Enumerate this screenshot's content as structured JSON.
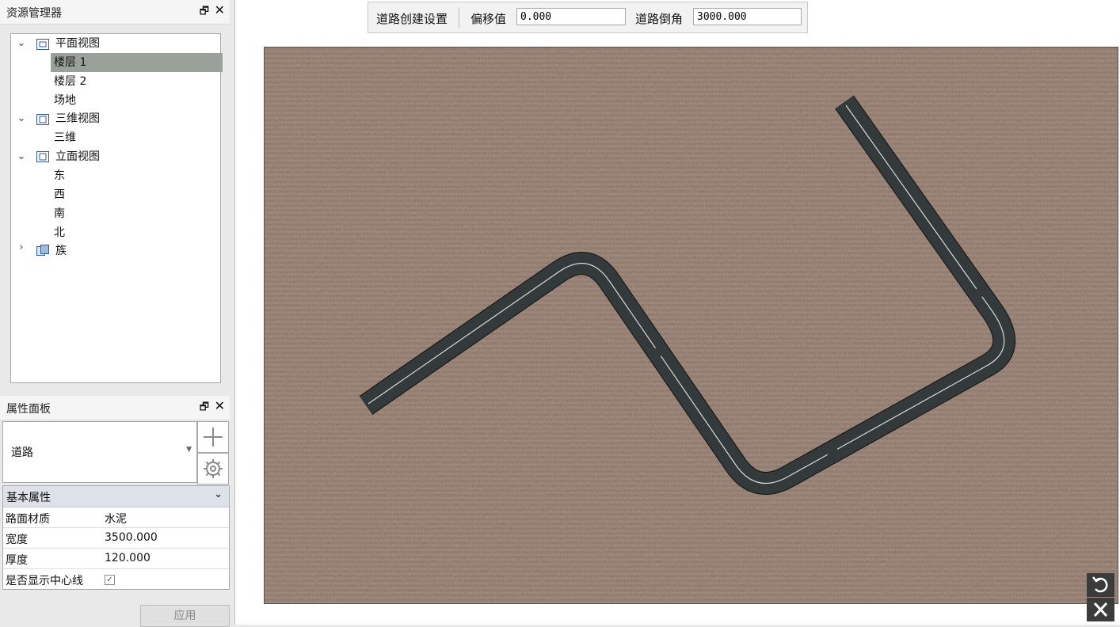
{
  "resource_panel": {
    "title": "资源管理器",
    "tree": [
      {
        "label": "平面视图",
        "icon": "plan-view-icon",
        "expanded": true
      },
      {
        "label": "楼层 1",
        "selected": true
      },
      {
        "label": "楼层 2"
      },
      {
        "label": "场地"
      },
      {
        "label": "三维视图",
        "icon": "3d-view-icon",
        "expanded": true
      },
      {
        "label": "三维"
      },
      {
        "label": "立面视图",
        "icon": "elevation-view-icon",
        "expanded": true
      },
      {
        "label": "东"
      },
      {
        "label": "西"
      },
      {
        "label": "南"
      },
      {
        "label": "北"
      },
      {
        "label": "族",
        "icon": "family-icon",
        "expanded": false
      }
    ]
  },
  "property_panel": {
    "title": "属性面板",
    "type_value": "道路",
    "section": "基本属性",
    "rows": [
      {
        "key": "路面材质",
        "value": "水泥"
      },
      {
        "key": "宽度",
        "value": "3500.000"
      },
      {
        "key": "厚度",
        "value": "120.000"
      },
      {
        "key": "是否显示中心线",
        "value": "✓"
      }
    ],
    "apply_label": "应用"
  },
  "toolbar": {
    "title": "道路创建设置",
    "offset_label": "偏移值",
    "offset_value": "0.000",
    "chamfer_label": "道路倒角",
    "chamfer_value": "3000.000"
  },
  "colors": {
    "ground": "#8d7466",
    "road": "#343a3c",
    "centerline": "#d9d9d9",
    "selected_row": "#9aa19b"
  }
}
